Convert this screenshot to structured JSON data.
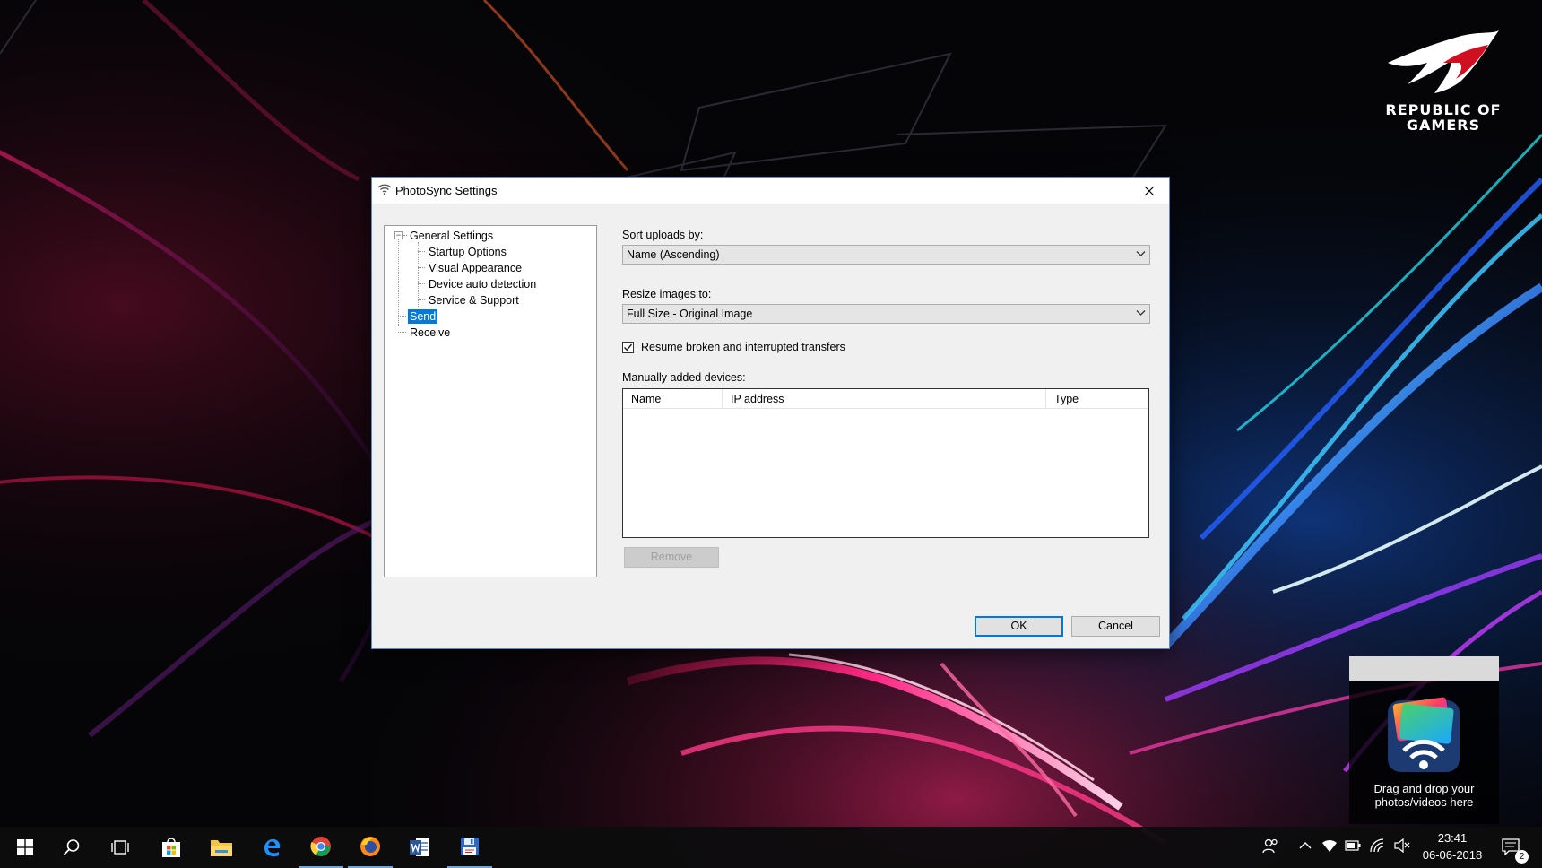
{
  "desktop": {
    "wallpaper_brand": "REPUBLIC OF\nGAMERS"
  },
  "dialog": {
    "title": "PhotoSync Settings",
    "tree": {
      "root": "General Settings",
      "children": [
        "Startup Options",
        "Visual Appearance",
        "Device auto detection",
        "Service & Support"
      ],
      "send": "Send",
      "receive": "Receive",
      "selected": "Send"
    },
    "sort_label": "Sort uploads by:",
    "sort_value": "Name (Ascending)",
    "resize_label": "Resize images to:",
    "resize_value": "Full Size - Original Image",
    "resume_label": "Resume broken and interrupted transfers",
    "resume_checked": true,
    "devices_label": "Manually added devices:",
    "devices_columns": [
      "Name",
      "IP address",
      "Type"
    ],
    "devices_rows": [],
    "remove_label": "Remove",
    "ok_label": "OK",
    "cancel_label": "Cancel"
  },
  "drop_widget": {
    "text": "Drag and drop your\nphotos/videos here",
    "icon": "photosync-wifi-icon"
  },
  "taskbar": {
    "pinned": [
      "start-icon",
      "search-icon",
      "task-view-icon",
      "store-icon",
      "file-explorer-icon",
      "edge-icon",
      "chrome-icon",
      "firefox-icon",
      "word-icon",
      "save-app-icon"
    ],
    "time": "23:41",
    "date": "06-06-2018",
    "notification_count": "2"
  },
  "colors": {
    "accent": "#0078d7",
    "dialog_bg": "#f0f0f0",
    "taskbar": "#0c0c0e"
  }
}
